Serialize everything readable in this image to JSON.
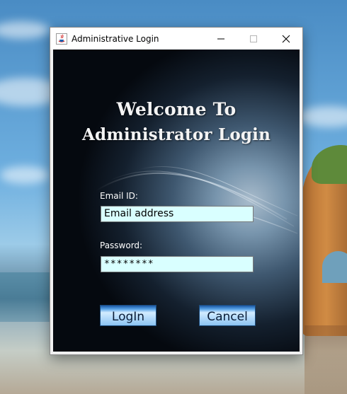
{
  "window": {
    "title": "Administrative Login",
    "controls": {
      "minimize_icon": "minimize-icon",
      "maximize_icon": "maximize-icon",
      "close_icon": "close-icon"
    }
  },
  "form": {
    "heading_line1": "Welcome To",
    "heading_line2": "Administrator Login",
    "email_label": "Email ID:",
    "email_value": "Email address",
    "password_label": "Password:",
    "password_value": "********",
    "login_label": "LogIn",
    "cancel_label": "Cancel"
  },
  "colors": {
    "field_background": "#d9ffff",
    "button_blue": "#b7dcfb",
    "heading_text": "#f4f4f4"
  }
}
